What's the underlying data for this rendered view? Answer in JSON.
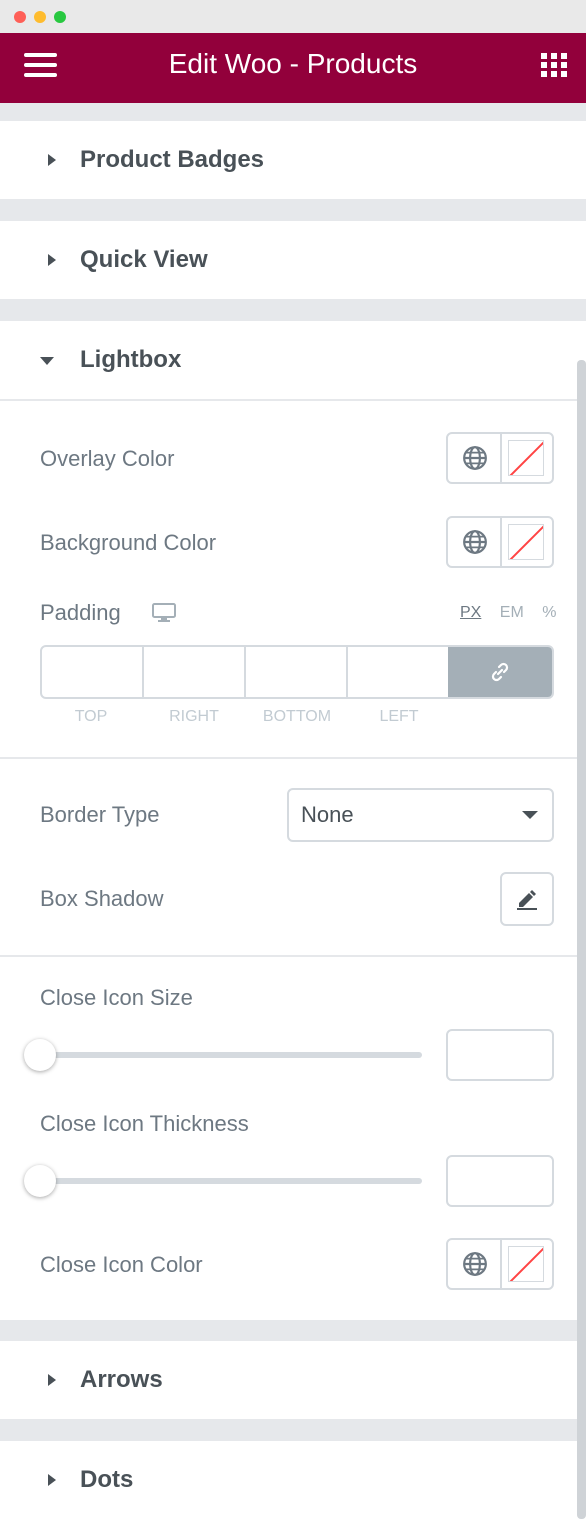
{
  "header": {
    "title": "Edit Woo - Products",
    "menu_icon": "hamburger-icon",
    "apps_icon": "grid-icon"
  },
  "sections": {
    "product_badges": "Product Badges",
    "quick_view": "Quick View",
    "lightbox": "Lightbox",
    "arrows": "Arrows",
    "dots": "Dots"
  },
  "lightbox": {
    "overlay_color": "Overlay Color",
    "background_color": "Background Color",
    "padding": {
      "label": "Padding",
      "units": [
        "PX",
        "EM",
        "%"
      ],
      "active_unit": "PX",
      "sides": [
        "TOP",
        "RIGHT",
        "BOTTOM",
        "LEFT"
      ]
    },
    "border_type": {
      "label": "Border Type",
      "value": "None"
    },
    "box_shadow": "Box Shadow",
    "close_icon_size": {
      "label": "Close Icon Size",
      "value": ""
    },
    "close_icon_thickness": {
      "label": "Close Icon Thickness",
      "value": ""
    },
    "close_icon_color": "Close Icon Color"
  },
  "colors": {
    "header": "#92003b",
    "heading_text": "#495157",
    "label_text": "#6d7882",
    "border": "#d5dadf",
    "link_button": "#a4afb7"
  }
}
